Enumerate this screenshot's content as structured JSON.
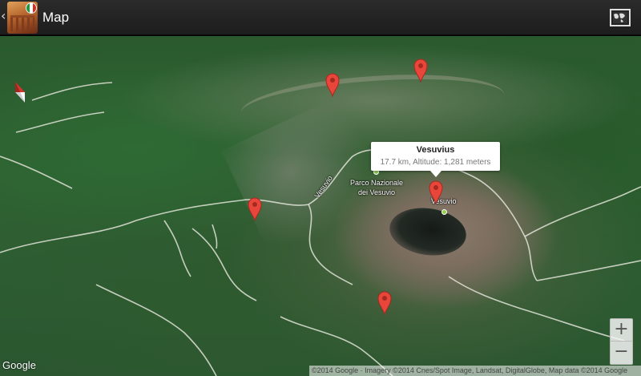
{
  "app": {
    "title": "Map",
    "back_chevron": "‹"
  },
  "icons": {
    "app_icon": "colosseum-italy-flag-icon",
    "map_type_button": "world-map-icon",
    "compass": "compass-icon",
    "marker": "map-pin-icon"
  },
  "colors": {
    "marker_red": "#e8463b",
    "actionbar": "#222222",
    "poi_green": "#8fcf4a"
  },
  "map": {
    "labels": {
      "road": "Vesuvio",
      "park_line1": "Parco Nazionale",
      "park_line2": "dei Vesuvio",
      "crater": "Vesuvio"
    },
    "info_window": {
      "title": "Vesuvius",
      "snippet": "17.7 km, Altitude: 1,281 meters"
    },
    "zoom_in_label": "+",
    "zoom_out_label": "−",
    "google_logo": "Google",
    "attribution": "©2014 Google · Imagery ©2014 Cnes/Spot Image, Landsat, DigitalGlobe, Map data ©2014 Google"
  }
}
